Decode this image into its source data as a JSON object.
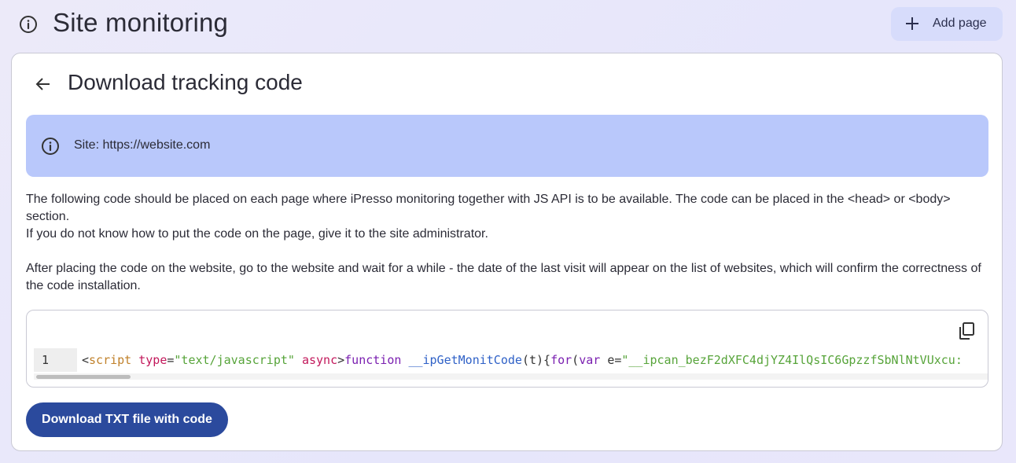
{
  "header": {
    "title": "Site monitoring",
    "add_page_label": "Add page"
  },
  "card": {
    "title": "Download tracking code",
    "info_text": "Site: https://website.com",
    "paragraphs": [
      "The following code should be placed on each page where iPresso monitoring together with JS API is to be available. The code can be placed in the <head> or <body> section.",
      "If you do not know how to put the code on the page, give it to the site administrator.",
      "After placing the code on the website, go to the website and wait for a while - the date of the last visit will appear on the list of websites, which will confirm the correctness of the code installation."
    ],
    "code": {
      "line_number": "1",
      "tokens": {
        "lt": "<",
        "tag": "script",
        "attr1": "type",
        "eq1": "=",
        "str1": "\"text/javascript\"",
        "attr2": "async",
        "gt": ">",
        "kw1": "function",
        "fn": "__ipGetMonitCode",
        "paren": "(t){",
        "kw2": "for",
        "open": "(",
        "kw3": "var",
        "var": "e",
        "eq2": "=",
        "str2": "\"__ipcan_bezF2dXFC4djYZ4IlQsIC6GpzzfSbNlNtVUxcu:"
      }
    },
    "download_label": "Download TXT file with code"
  },
  "icons": {
    "top_info": "info-circle-icon",
    "back": "arrow-left-icon",
    "info_box": "info-circle-icon",
    "copy": "copy-icon",
    "add": "plus-icon"
  },
  "colors": {
    "info_box_bg": "#b9c8fb",
    "primary_button": "#2b4a9d",
    "add_button_bg": "#d7dcfb"
  }
}
